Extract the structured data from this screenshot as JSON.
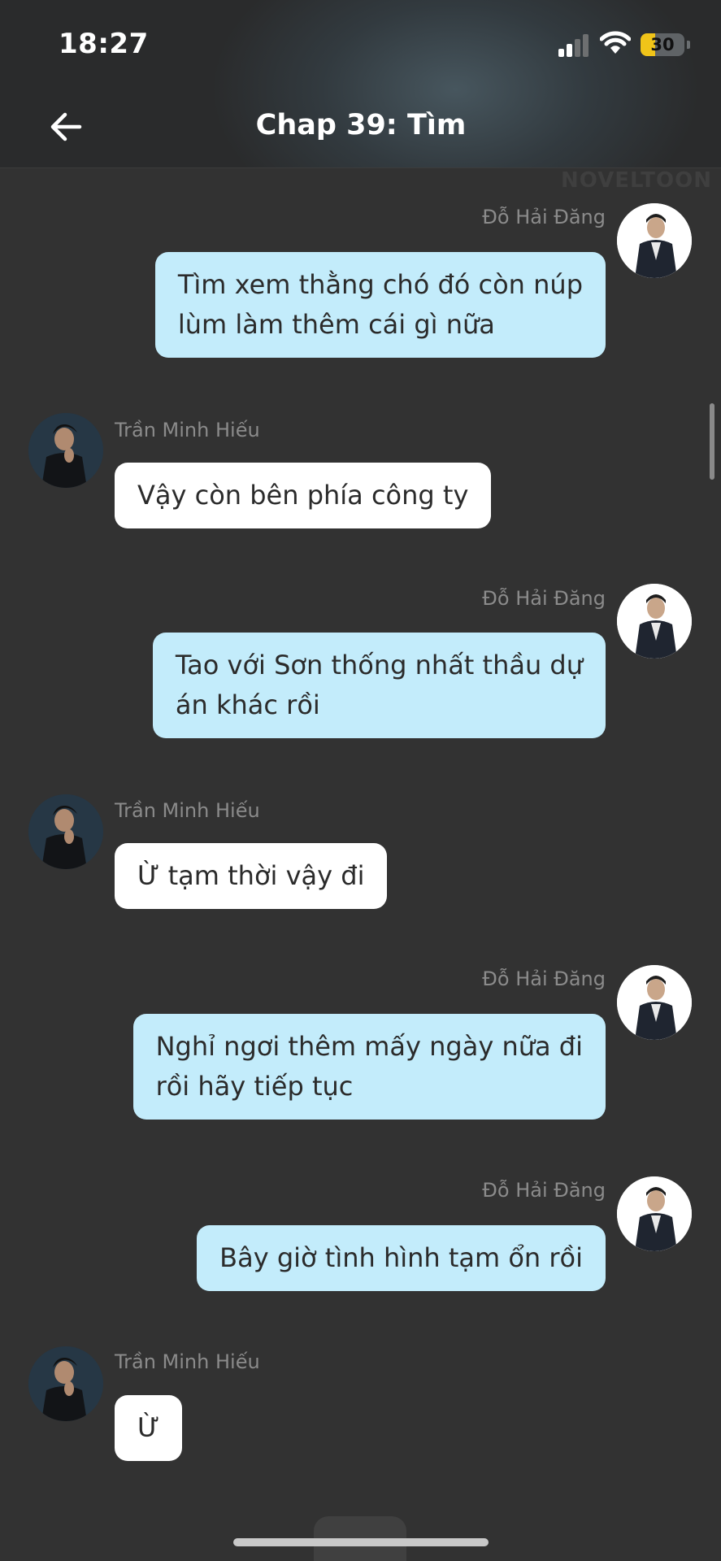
{
  "status_bar": {
    "time": "18:27",
    "battery_level": "30",
    "battery_color": "#f0c419"
  },
  "header": {
    "title": "Chap 39: Tìm",
    "back_icon": "arrow-left-icon"
  },
  "watermark": "NOVELTOON",
  "messages": [
    {
      "side": "right",
      "sender": "Đỗ Hải Đăng",
      "lines": [
        "Tìm xem thằng chó đó còn núp",
        "lùm làm thêm cái gì nữa"
      ]
    },
    {
      "side": "left",
      "sender": "Trần Minh Hiếu",
      "lines": [
        "Vậy còn bên phía công ty"
      ]
    },
    {
      "side": "right",
      "sender": "Đỗ Hải Đăng",
      "lines": [
        "Tao với Sơn thống nhất thầu dự",
        "án khác rồi"
      ]
    },
    {
      "side": "left",
      "sender": "Trần Minh Hiếu",
      "lines": [
        "Ừ tạm thời vậy đi"
      ]
    },
    {
      "side": "right",
      "sender": "Đỗ Hải Đăng",
      "lines": [
        "Nghỉ ngơi thêm mấy ngày nữa đi",
        "rồi hãy tiếp tục"
      ]
    },
    {
      "side": "right",
      "sender": "Đỗ Hải Đăng",
      "lines": [
        "Bây giờ tình hình tạm ổn rồi"
      ]
    },
    {
      "side": "left",
      "sender": "Trần Minh Hiếu",
      "lines": [
        "Ừ"
      ]
    }
  ],
  "colors": {
    "background": "#323232",
    "right_bubble": "#c3ecfb",
    "left_bubble": "#ffffff",
    "name_text": "#8b8b8b"
  }
}
